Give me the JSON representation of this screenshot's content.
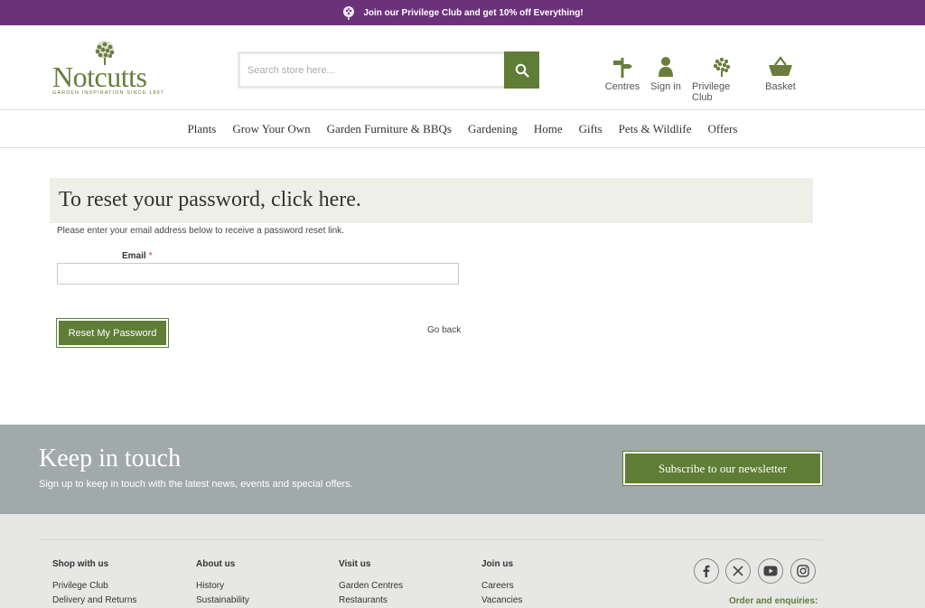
{
  "promo": {
    "text": "Join our Privilege Club and get 10% off Everything!"
  },
  "logo": {
    "name": "Notcutts",
    "tagline": "GARDEN INSPIRATION SINCE 1897"
  },
  "search": {
    "placeholder": "Search store here..."
  },
  "header_links": {
    "centres": "Centres",
    "sign_in": "Sign in",
    "privilege_club": "Privilege Club",
    "basket": "Basket"
  },
  "nav": [
    "Plants",
    "Grow Your Own",
    "Garden Furniture & BBQs",
    "Gardening",
    "Home",
    "Gifts",
    "Pets & Wildlife",
    "Offers"
  ],
  "main": {
    "title": "To reset your password, click here.",
    "intro": "Please enter your email address below to receive a password reset link.",
    "email_label": "Email",
    "required_mark": "*",
    "reset_button": "Reset My Password",
    "go_back": "Go back"
  },
  "keep_in_touch": {
    "title": "Keep in touch",
    "text": "Sign up to keep in touch with the latest news, events and special offers.",
    "button": "Subscribe to our newsletter"
  },
  "footer": {
    "columns": [
      {
        "title": "Shop with us",
        "links": [
          "Privilege Club",
          "Delivery and Returns"
        ]
      },
      {
        "title": "About us",
        "links": [
          "History",
          "Sustainability"
        ]
      },
      {
        "title": "Visit us",
        "links": [
          "Garden Centres",
          "Restaurants"
        ]
      },
      {
        "title": "Join us",
        "links": [
          "Careers",
          "Vacancies"
        ]
      }
    ],
    "social_icons": [
      "facebook-icon",
      "x-icon",
      "youtube-icon",
      "instagram-icon"
    ],
    "order_text": "Order and enquiries:"
  },
  "colors": {
    "promo": "#6b3279",
    "brand_green": "#5f7d36",
    "keep_in_touch_bg": "#a1aaab",
    "footer_bg": "#e7e7e5"
  }
}
